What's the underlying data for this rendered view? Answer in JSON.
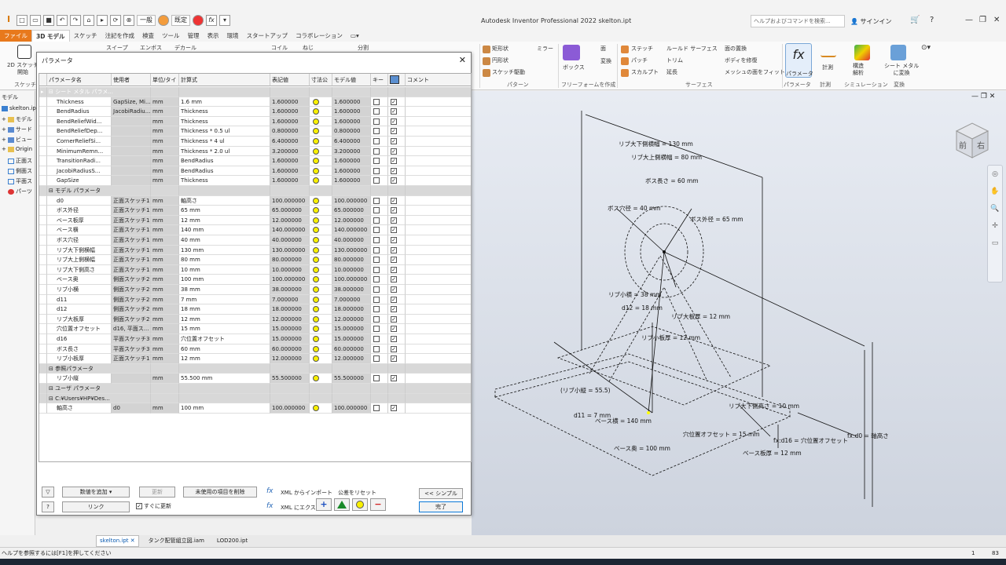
{
  "window": {
    "title": "Autodesk Inventor Professional 2022   skelton.ipt",
    "search_placeholder": "ヘルプおよびコマンドを検索...",
    "signin": "サインイン",
    "qat_appearance": "一般",
    "qat_material": "既定"
  },
  "ribbon_tabs": [
    "ファイル",
    "3D モデル",
    "スケッチ",
    "注記を作成",
    "検査",
    "ツール",
    "管理",
    "表示",
    "環境",
    "スタートアップ",
    "コラボレーション"
  ],
  "ribbon": {
    "sketch_start": "2D スケッチ\n開始",
    "sketch_group": "スケッチ",
    "sweep": "スイープ",
    "emboss": "エンボス",
    "decal": "デカール",
    "coil": "コイル",
    "thread": "ねじ",
    "split": "分割",
    "rect": "矩形状",
    "circ": "円形状",
    "sketch_drive": "スケッチ駆動",
    "mirror": "ミラー",
    "pattern_group": "パターン",
    "box": "ボックス",
    "face": "面",
    "convert": "変換",
    "freeform_group": "フリーフォームを作成",
    "stitch": "ステッチ",
    "patch": "パッチ",
    "sculpt": "スカルプト",
    "ruled": "ルールド サーフェス",
    "trim": "トリム",
    "extend": "延長",
    "replace_face": "面の置換",
    "repair": "ボディを修復",
    "fit_mesh": "メッシュの面をフィット",
    "surface_group": "サーフェス",
    "parameters": "パラメータ",
    "measure": "計測",
    "structural": "構造\n解析",
    "sim_group": "シミュレーション",
    "sheetmetal": "シート メタル\nに変換",
    "convert_group": "変換",
    "param_group": "パラメータ",
    "measure_group": "計測"
  },
  "browser": {
    "title": "モデル",
    "items": [
      "skelton.ipt",
      "モデル",
      "サード",
      "ビュー",
      "Origin",
      "正面ス",
      "側面ス",
      "平面ス",
      "パーツ"
    ]
  },
  "dialog": {
    "title": "パラメータ",
    "columns": [
      "パラメータ名",
      "使用者",
      "単位/タイ",
      "計算式",
      "表記値",
      "寸法公",
      "モデル値",
      "キー",
      "",
      "コメント"
    ],
    "rows": [
      {
        "type": "group",
        "name": "シート メタル パラメ...",
        "selected": true
      },
      {
        "name": "Thickness",
        "user": "GapSize, Mi...",
        "unit": "mm",
        "expr": "1.6 mm",
        "nominal": "1.600000",
        "model": "1.600000",
        "export": true
      },
      {
        "name": "BendRadius",
        "user": "JacobiRadiu...",
        "unit": "mm",
        "expr": "Thickness",
        "nominal": "1.600000",
        "model": "1.600000",
        "export": true
      },
      {
        "name": "BendReliefWid...",
        "user": "",
        "unit": "mm",
        "expr": "Thickness",
        "nominal": "1.600000",
        "model": "1.600000",
        "export": true
      },
      {
        "name": "BendReliefDep...",
        "user": "",
        "unit": "mm",
        "expr": "Thickness * 0.5 ul",
        "nominal": "0.800000",
        "model": "0.800000",
        "export": true
      },
      {
        "name": "CornerReliefSi...",
        "user": "",
        "unit": "mm",
        "expr": "Thickness * 4 ul",
        "nominal": "6.400000",
        "model": "6.400000",
        "export": true
      },
      {
        "name": "MinimumRemn...",
        "user": "",
        "unit": "mm",
        "expr": "Thickness * 2.0 ul",
        "nominal": "3.200000",
        "model": "3.200000",
        "export": true
      },
      {
        "name": "TransitionRadi...",
        "user": "",
        "unit": "mm",
        "expr": "BendRadius",
        "nominal": "1.600000",
        "model": "1.600000",
        "export": true
      },
      {
        "name": "JacobiRadiusS...",
        "user": "",
        "unit": "mm",
        "expr": "BendRadius",
        "nominal": "1.600000",
        "model": "1.600000",
        "export": true
      },
      {
        "name": "GapSize",
        "user": "",
        "unit": "mm",
        "expr": "Thickness",
        "nominal": "1.600000",
        "model": "1.600000",
        "export": true
      },
      {
        "type": "group",
        "name": "モデル パラメータ"
      },
      {
        "name": "d0",
        "user": "正面スケッチ1",
        "unit": "mm",
        "expr": "軸高さ",
        "nominal": "100.000000",
        "model": "100.000000",
        "export": true
      },
      {
        "name": "ボス外径",
        "user": "正面スケッチ1",
        "unit": "mm",
        "expr": "65 mm",
        "nominal": "65.000000",
        "model": "65.000000",
        "export": true
      },
      {
        "name": "ベース板厚",
        "user": "正面スケッチ1",
        "unit": "mm",
        "expr": "12 mm",
        "nominal": "12.000000",
        "model": "12.000000",
        "export": true
      },
      {
        "name": "ベース横",
        "user": "正面スケッチ1",
        "unit": "mm",
        "expr": "140 mm",
        "nominal": "140.000000",
        "model": "140.000000",
        "export": true
      },
      {
        "name": "ボス穴径",
        "user": "正面スケッチ1",
        "unit": "mm",
        "expr": "40 mm",
        "nominal": "40.000000",
        "model": "40.000000",
        "export": true
      },
      {
        "name": "リブ大下側横幅",
        "user": "正面スケッチ1",
        "unit": "mm",
        "expr": "130 mm",
        "nominal": "130.000000",
        "model": "130.000000",
        "export": true
      },
      {
        "name": "リブ大上側横幅",
        "user": "正面スケッチ1",
        "unit": "mm",
        "expr": "80 mm",
        "nominal": "80.000000",
        "model": "80.000000",
        "export": true
      },
      {
        "name": "リブ大下側高さ",
        "user": "正面スケッチ1",
        "unit": "mm",
        "expr": "10 mm",
        "nominal": "10.000000",
        "model": "10.000000",
        "export": true
      },
      {
        "name": "ベース奥",
        "user": "側面スケッチ2",
        "unit": "mm",
        "expr": "100 mm",
        "nominal": "100.000000",
        "model": "100.000000",
        "export": true
      },
      {
        "name": "リブ小横",
        "user": "側面スケッチ2",
        "unit": "mm",
        "expr": "38 mm",
        "nominal": "38.000000",
        "model": "38.000000",
        "export": true
      },
      {
        "name": "d11",
        "user": "側面スケッチ2",
        "unit": "mm",
        "expr": "7 mm",
        "nominal": "7.000000",
        "model": "7.000000",
        "export": true
      },
      {
        "name": "d12",
        "user": "側面スケッチ2",
        "unit": "mm",
        "expr": "18 mm",
        "nominal": "18.000000",
        "model": "18.000000",
        "export": true
      },
      {
        "name": "リブ大板厚",
        "user": "側面スケッチ2",
        "unit": "mm",
        "expr": "12 mm",
        "nominal": "12.000000",
        "model": "12.000000",
        "export": true
      },
      {
        "name": "穴位置オフセット",
        "user": "d16, 平面ス...",
        "unit": "mm",
        "expr": "15 mm",
        "nominal": "15.000000",
        "model": "15.000000",
        "export": true
      },
      {
        "name": "d16",
        "user": "平面スケッチ3",
        "unit": "mm",
        "expr": "穴位置オフセット",
        "nominal": "15.000000",
        "model": "15.000000",
        "export": true
      },
      {
        "name": "ボス長さ",
        "user": "平面スケッチ3",
        "unit": "mm",
        "expr": "60 mm",
        "nominal": "60.000000",
        "model": "60.000000",
        "export": true
      },
      {
        "name": "リブ小板厚",
        "user": "正面スケッチ1",
        "unit": "mm",
        "expr": "12 mm",
        "nominal": "12.000000",
        "model": "12.000000",
        "export": true
      },
      {
        "type": "group",
        "name": "参照パラメータ"
      },
      {
        "name": "リブ小縦",
        "user": "",
        "unit": "mm",
        "expr": "55.500 mm",
        "nominal": "55.500000",
        "model": "55.500000",
        "export": true
      },
      {
        "type": "group",
        "name": "ユーザ パラメータ"
      },
      {
        "type": "group",
        "name": "C:¥Users¥HP¥Des..."
      },
      {
        "name": "軸高さ",
        "user": "d0",
        "unit": "mm",
        "expr": "100 mm",
        "nominal": "100.000000",
        "model": "100.000000",
        "export": true
      }
    ],
    "buttons": {
      "add_value": "数値を追加",
      "update": "更新",
      "purge": "未使用の項目を削除",
      "xml_import": "XML からインポート",
      "tol_reset": "公差をリセット",
      "link": "リンク",
      "immediate": "すぐに更新",
      "xml_export": "XML にエクスポート",
      "simple": "<< シンプル",
      "done": "完了"
    }
  },
  "viewport_labels": [
    "リブ大下側横幅 = 130 mm",
    "リブ大上側横幅 = 80 mm",
    "ボス長さ = 60 mm",
    "ボス穴径 = 40 mm",
    "ボス外径 = 65 mm",
    "リブ小横 = 38 mm",
    "d12 = 18 mm",
    "リブ大板厚 = 12 mm",
    "リブ小板厚 = 12 mm",
    "(リブ小縦 = 55.5)",
    "d11 = 7 mm",
    "ベース横 = 140 mm",
    "リブ大下側高さ = 10 mm",
    "穴位置オフセット = 15 mm",
    "fx:d16 = 穴位置オフセット",
    "fx:d0 = 軸高さ",
    "ベース奥 = 100 mm",
    "ベース板厚 = 12 mm"
  ],
  "viewcube": {
    "front": "前",
    "right": "右"
  },
  "doc_tabs": [
    "skelton.ipt",
    "タンク配管組立図.iam",
    "LOD200.ipt"
  ],
  "status": {
    "text": "ヘルプを参照するには[F1]を押してください",
    "n1": "1",
    "n2": "83"
  },
  "colors": {
    "accent": "#0a78d7",
    "file_tab": "#e8791c",
    "tol_dot": "#f8f000"
  }
}
